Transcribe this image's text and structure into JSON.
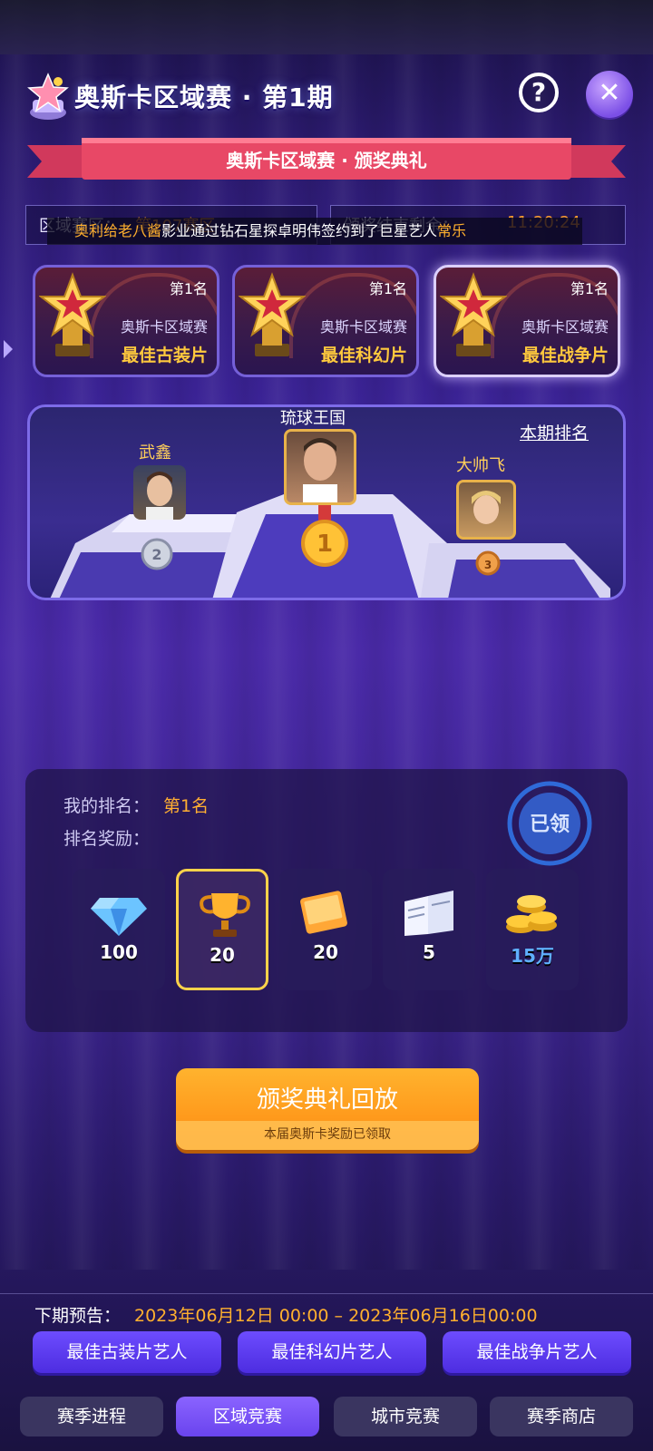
{
  "header": {
    "title": "奥斯卡区域赛 · 第1期",
    "help_label": "?",
    "close_label": "✕"
  },
  "ribbon": {
    "text": "奥斯卡区域赛 · 颁奖典礼"
  },
  "info": {
    "zone_label": "区域赛区：",
    "zone_value": "第107赛区",
    "countdown_label": "颁奖结束剩余：",
    "countdown_value": "11:20:24"
  },
  "ticker": {
    "name1": "奥利给老八酱",
    "middle": "影业通过钻石星探卓明伟签约到了巨星艺人",
    "name2": "常乐"
  },
  "awards": [
    {
      "rank": "第1名",
      "region": "奥斯卡区域赛",
      "category": "最佳古装片"
    },
    {
      "rank": "第1名",
      "region": "奥斯卡区域赛",
      "category": "最佳科幻片"
    },
    {
      "rank": "第1名",
      "region": "奥斯卡区域赛",
      "category": "最佳战争片"
    }
  ],
  "podium": {
    "rank_link": "本期排名",
    "first": "琉球王国",
    "second": "武鑫",
    "third": "大帅飞"
  },
  "my": {
    "rank_label": "我的排名：",
    "rank_value": "第1名",
    "reward_label": "排名奖励：",
    "stamp_text": "已领",
    "rewards": [
      {
        "icon": "diamond-icon",
        "amount": "100"
      },
      {
        "icon": "trophy-icon",
        "amount": "20"
      },
      {
        "icon": "ticket-book-icon",
        "amount": "20"
      },
      {
        "icon": "contract-icon",
        "amount": "5"
      },
      {
        "icon": "gold-coins-icon",
        "amount": "15万"
      }
    ]
  },
  "replay": {
    "label": "颁奖典礼回放",
    "sub": "本届奥斯卡奖励已领取"
  },
  "next": {
    "label": "下期预告：",
    "value": "2023年06月12日 00:00 – 2023年06月16日00:00",
    "buttons": [
      "最佳古装片艺人",
      "最佳科幻片艺人",
      "最佳战争片艺人"
    ]
  },
  "nav": {
    "items": [
      "赛季进程",
      "区域竞赛",
      "城市竞赛",
      "赛季商店"
    ],
    "active": "区域竞赛"
  },
  "colors": {
    "accent_orange": "#ffb02e",
    "accent_purple": "#6a44ee",
    "gold": "#ffc93d"
  }
}
